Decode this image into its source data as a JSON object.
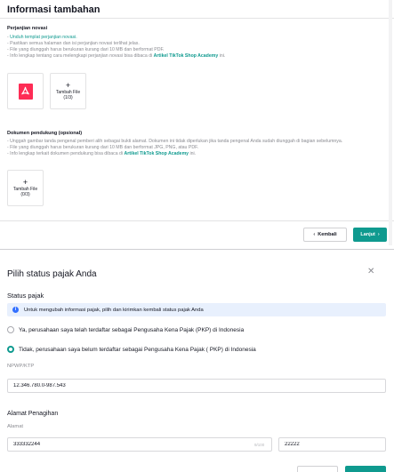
{
  "background": {
    "title": "Informasi tambahan",
    "novasi": {
      "heading": "Perjanjian novasi",
      "bullets": {
        "b1": "Unduh templat perjanjian novasi.",
        "b2": "Pastikan semua halaman dan isi perjanjian novasi terlihat jelas.",
        "b3": "File yang diunggah harus berukuran kurang dari 10 MB dan berformat PDF.",
        "b4_prefix": "Info lengkap tentang cara melengkapi perjanjian novasi bisa dibaca di ",
        "b4_link": "Artikel TikTok Shop Academy",
        "b4_suffix": " ini."
      },
      "pdf_icon": "pdf-file-icon",
      "add_file": {
        "label": "Tambah File",
        "count": "(1/3)"
      }
    },
    "pendukung": {
      "heading": "Dokumen pendukung (opsional)",
      "bullets": {
        "b1": "Unggah gambar tanda pengenal pemberi alih sebagai bukti alamat. Dokumen ini tidak diperlukan jika tanda pengenal Anda sudah diunggah di bagian sebelumnya.",
        "b2": "File yang diunggah harus berukuran kurang dari 10 MB dan berformat JPG, PNG, atau PDF.",
        "b3_prefix": "Info lengkap terkait dokumen pendukung bisa dibaca di ",
        "b3_link": "Artikel TikTok Shop Academy",
        "b3_suffix": " ini."
      },
      "add_file": {
        "label": "Tambah File",
        "count": "(0/3)"
      }
    },
    "footer": {
      "back_label": "Kembali",
      "next_label": "Lanjut"
    }
  },
  "modal": {
    "title": "Pilih status pajak Anda",
    "close_icon": "close-icon",
    "status_label": "Status pajak",
    "info_text": "Untuk mengubah informasi pajak, pilih dan kirimkan kembali status pajak Anda",
    "options": [
      {
        "label": "Ya, perusahaan saya telah terdaftar sebagai Pengusaha Kena Pajak (PKP) di Indonesia",
        "selected": false
      },
      {
        "label": "Tidak, perusahaan saya belum terdaftar sebagai Pengusaha Kena Pajak ( PKP) di Indonesia",
        "selected": true
      }
    ],
    "npwp": {
      "label": "NPWP/KTP",
      "value": "12.346.780.0-987.543"
    },
    "billing": {
      "title": "Alamat Penagihan",
      "address_label": "Alamat",
      "address_value": "333332244",
      "address_counter": "9/100",
      "postal_value": "22222"
    }
  },
  "colors": {
    "accent": "#0f9a8f",
    "pdf": "#fe2c55",
    "info": "#3370ff"
  }
}
